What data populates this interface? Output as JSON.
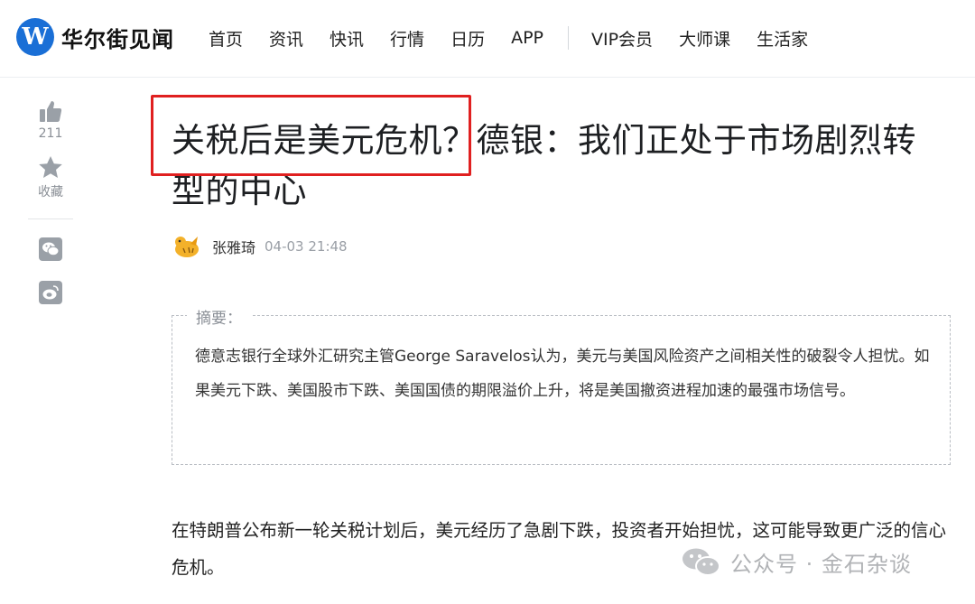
{
  "header": {
    "logo_letter": "W",
    "logo_text": "华尔街见闻",
    "nav": [
      "首页",
      "资讯",
      "快讯",
      "行情",
      "日历",
      "APP"
    ],
    "nav_right": [
      "VIP会员",
      "大师课",
      "生活家"
    ]
  },
  "sidebar": {
    "like_count": "211",
    "favorite_label": "收藏",
    "share_icons": [
      "wechat-icon",
      "weibo-icon"
    ]
  },
  "article": {
    "title": "关税后是美元危机？德银：我们正处于市场剧烈转型的中心",
    "author": "张雅琦",
    "time": "04-03 21:48",
    "summary_label": "摘要：",
    "summary": "德意志银行全球外汇研究主管George Saravelos认为，美元与美国风险资产之间相关性的破裂令人担忧。如果美元下跌、美国股市下跌、美国国债的期限溢价上升，将是美国撤资进程加速的最强市场信号。",
    "body": "在特朗普公布新一轮关税计划后，美元经历了急剧下跌，投资者开始担忧，这可能导致更广泛的信心危机。"
  },
  "watermark": {
    "text": "公众号 · 金石杂谈"
  },
  "colors": {
    "brand": "#1a6fd6",
    "highlight_box": "#e02020",
    "muted": "#9aa0a7"
  }
}
